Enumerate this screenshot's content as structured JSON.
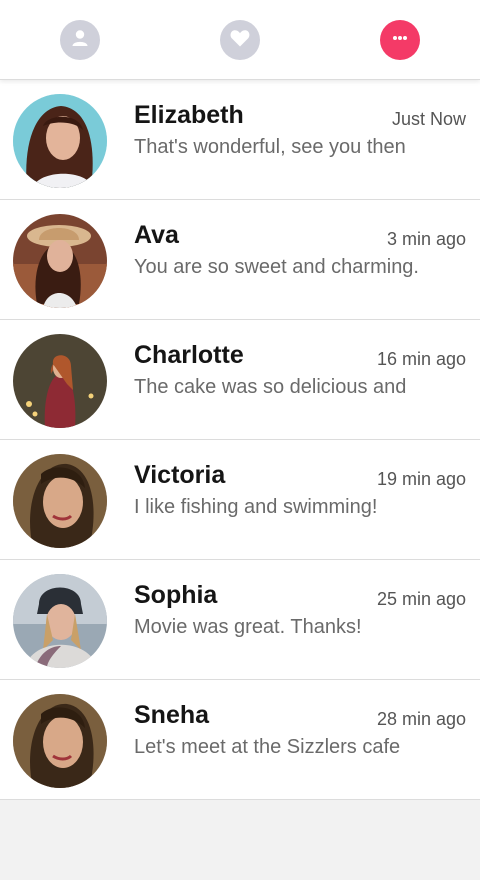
{
  "tabs": [
    {
      "icon": "user-icon",
      "color": "#cfd0da"
    },
    {
      "icon": "heart-icon",
      "color": "#cfd0da"
    },
    {
      "icon": "chat-bubble-icon",
      "color": "#f43a67",
      "active": true
    }
  ],
  "conversations": [
    {
      "name": "Elizabeth",
      "time": "Just Now",
      "message": "That's wonderful, see you then"
    },
    {
      "name": "Ava",
      "time": "3 min ago",
      "message": "You are so sweet and charming."
    },
    {
      "name": "Charlotte",
      "time": "16 min ago",
      "message": "The cake was so delicious and"
    },
    {
      "name": "Victoria",
      "time": "19 min ago",
      "message": "I like fishing and swimming!"
    },
    {
      "name": "Sophia",
      "time": "25 min ago",
      "message": "Movie was great. Thanks!"
    },
    {
      "name": "Sneha",
      "time": "28 min ago",
      "message": "Let's meet at the Sizzlers cafe"
    }
  ]
}
